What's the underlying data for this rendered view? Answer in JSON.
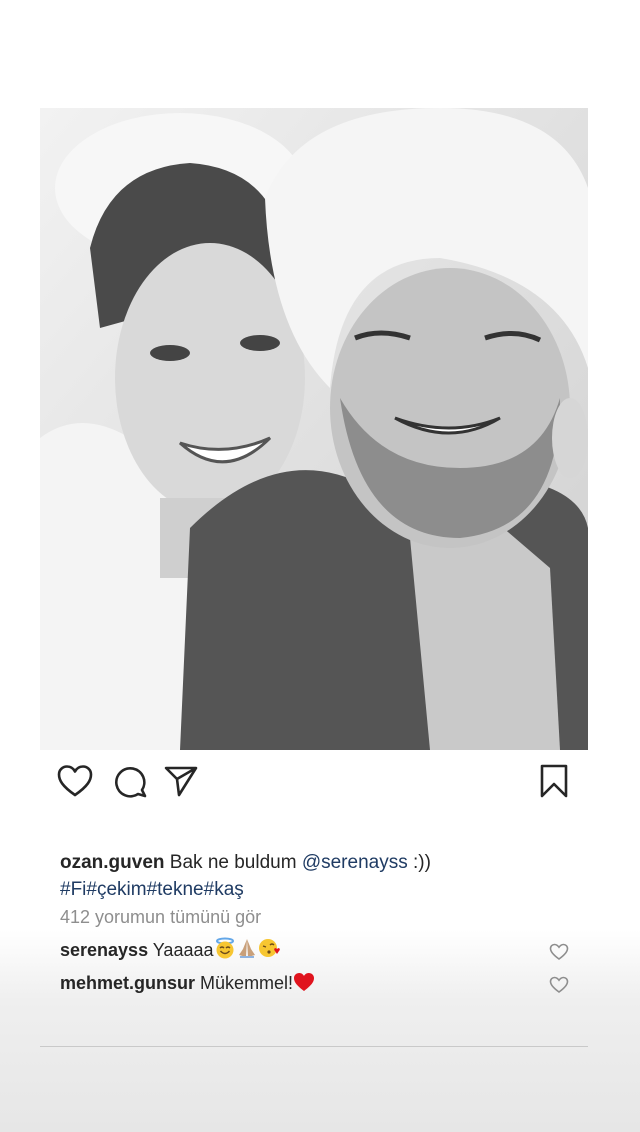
{
  "post": {
    "username": "ozan.guven",
    "caption_text": "Bak ne buldum",
    "mention": "@serenayss",
    "caption_end": ":))",
    "hashtags": "#Fi#çekim#tekne#kaş",
    "view_all_comments": "412 yorumun tümünü gör"
  },
  "comments": [
    {
      "username": "serenayss",
      "text": "Yaaaaa",
      "emojis": [
        "smiling-halo-emoji",
        "praying-hands-emoji",
        "face-blowing-kiss-emoji"
      ]
    },
    {
      "username": "mehmet.gunsur",
      "text": "Mükemmel!",
      "emojis": [
        "red-heart-emoji"
      ]
    }
  ],
  "icons": {
    "like": "heart-icon",
    "comment": "comment-bubble-icon",
    "share": "paper-plane-icon",
    "save": "bookmark-icon"
  },
  "colors": {
    "mention": "#1f3b63",
    "heart": "#e0141e",
    "muted": "#8e8e8e"
  }
}
